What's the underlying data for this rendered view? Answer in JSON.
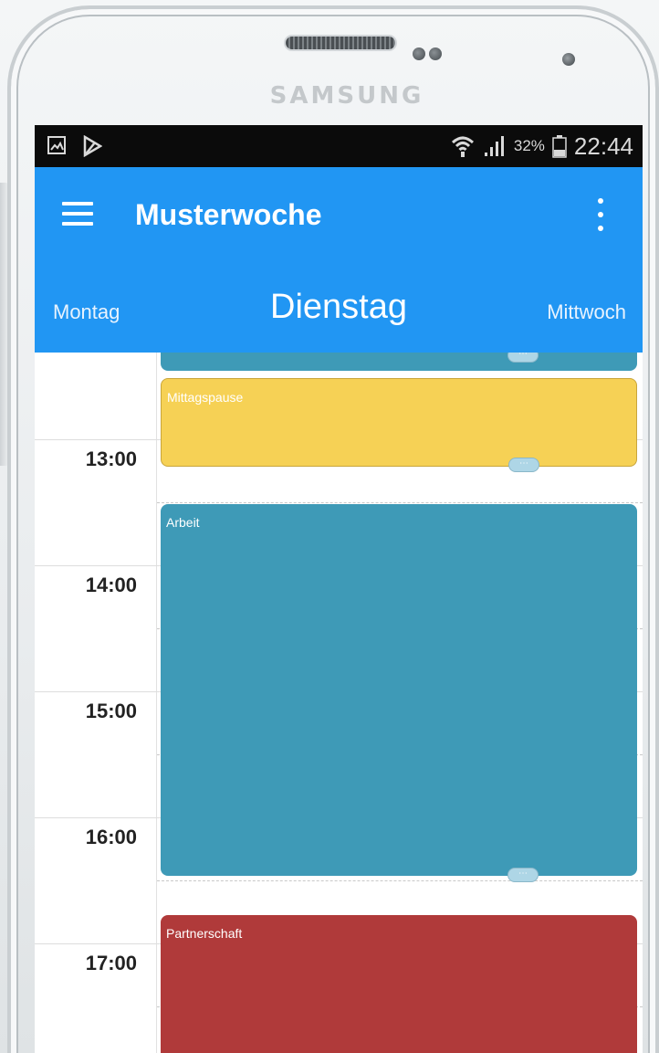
{
  "device": {
    "brand": "SAMSUNG"
  },
  "status_bar": {
    "battery_percent": "32%",
    "time": "22:44",
    "left_icons": [
      "image-notification-icon",
      "media-notification-icon"
    ],
    "right_icons": [
      "wifi-icon",
      "signal-icon",
      "battery-icon"
    ]
  },
  "app_bar": {
    "title": "Musterwoche",
    "menu_icon": "hamburger-menu-icon",
    "overflow_icon": "more-vertical-icon",
    "day_prev": "Montag",
    "day_current": "Dienstag",
    "day_next": "Mittwoch",
    "color": "#2196f3"
  },
  "calendar": {
    "hours": [
      "13:00",
      "14:00",
      "15:00",
      "16:00",
      "17:00"
    ],
    "events": [
      {
        "label": "",
        "color": "#3e9ab7"
      },
      {
        "label": "Mittagspause",
        "color": "#f6d155"
      },
      {
        "label": "Arbeit",
        "color": "#3e9ab7"
      },
      {
        "label": "Partnerschaft",
        "color": "#b03a3a"
      }
    ],
    "handle_text": "⋯"
  }
}
